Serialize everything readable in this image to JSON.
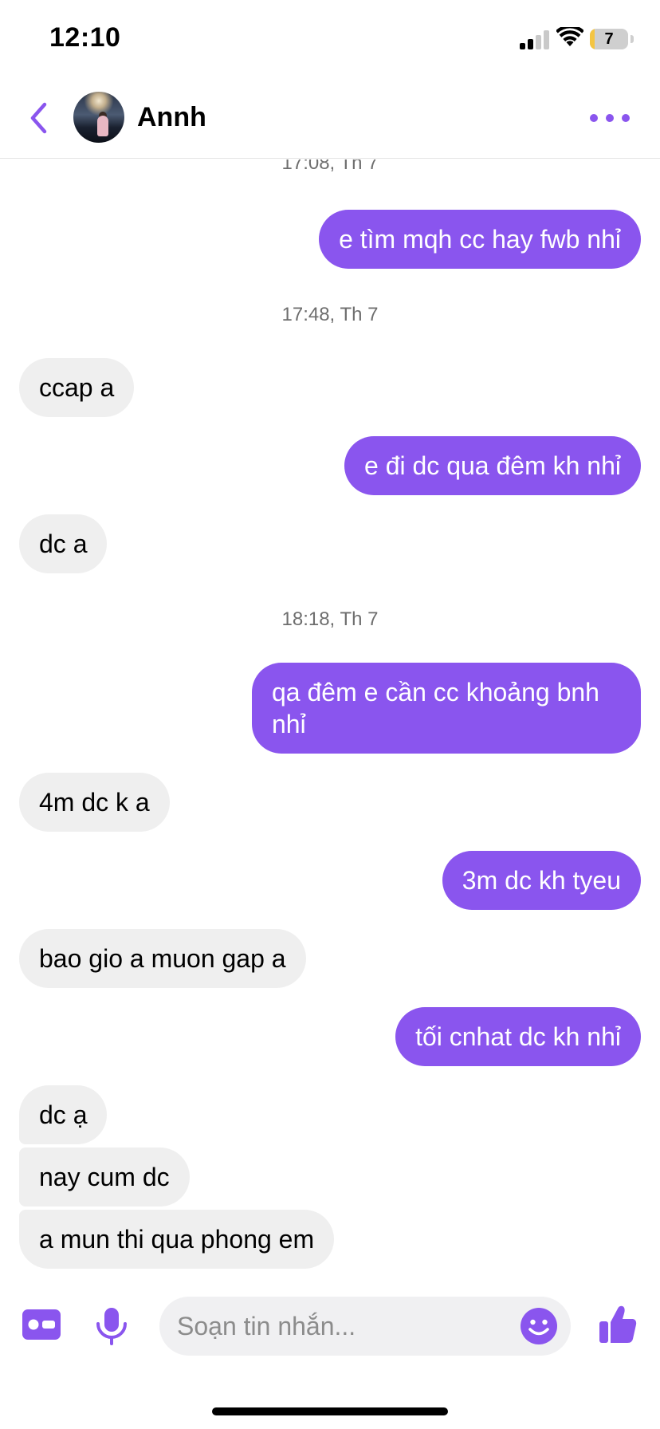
{
  "status_bar": {
    "time": "12:10",
    "battery_level": "7",
    "battery_fraction": 0.07,
    "signal_bars_filled": 2,
    "signal_bars_total": 4
  },
  "header": {
    "contact_name": "Annh",
    "back_icon": "chevron-left-icon",
    "more_icon": "more-horizontal-icon"
  },
  "colors": {
    "accent": "#8a55ee",
    "received_bubble": "#efefef",
    "timestamp_text": "#6e6e6e"
  },
  "conversation": {
    "timestamps": [
      "17:08, Th 7",
      "17:48, Th 7",
      "18:18, Th 7"
    ],
    "messages": [
      {
        "from": "me",
        "text": "e tìm mqh cc hay fwb nhỉ"
      },
      {
        "from": "them",
        "text": "ccap a"
      },
      {
        "from": "me",
        "text": "e đi dc qua đêm kh nhỉ"
      },
      {
        "from": "them",
        "text": "dc a"
      },
      {
        "from": "me",
        "text": "qa đêm e cần cc khoảng bnh nhỉ"
      },
      {
        "from": "them",
        "text": "4m dc k a"
      },
      {
        "from": "me",
        "text": "3m dc kh tyeu"
      },
      {
        "from": "them",
        "text": "bao gio a muon gap a"
      },
      {
        "from": "me",
        "text": "tối cnhat dc kh nhỉ"
      },
      {
        "from": "them",
        "text": "dc ạ"
      },
      {
        "from": "them",
        "text": "nay cum dc"
      },
      {
        "from": "them",
        "text": "a mun thi qua phong em"
      }
    ]
  },
  "composer": {
    "placeholder": "Soạn tin nhắn...",
    "value": "",
    "icons": [
      "contact-card-icon",
      "microphone-icon",
      "emoji-icon",
      "thumbs-up-icon"
    ]
  }
}
